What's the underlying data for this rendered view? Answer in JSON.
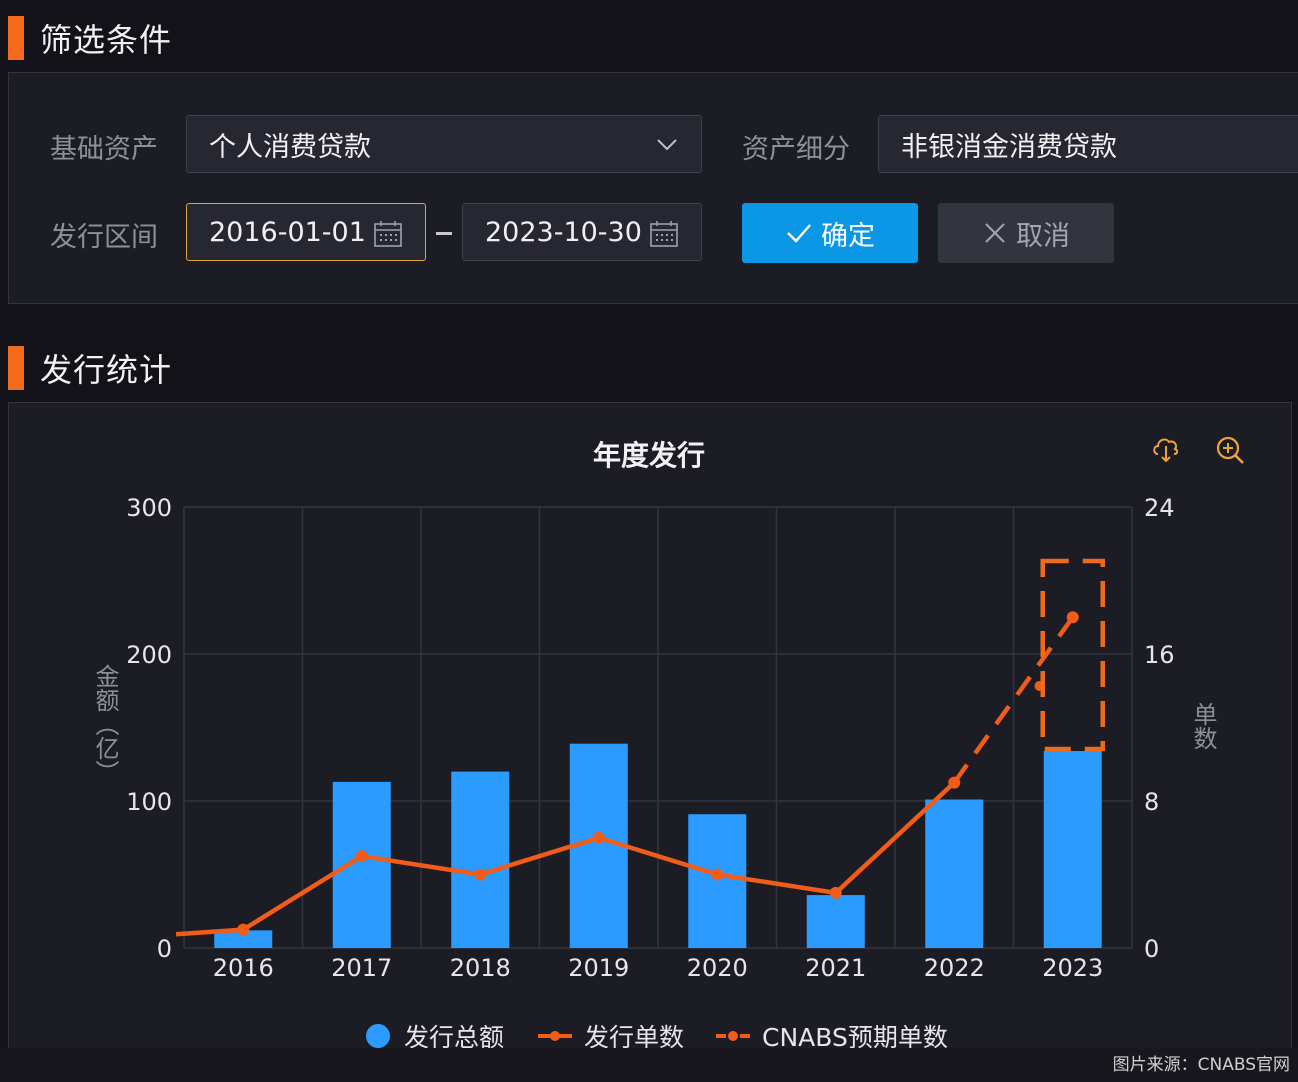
{
  "colors": {
    "accent": "#f26a1b",
    "primary": "#2b9bff",
    "confirm": "#0b96e6",
    "series_line": "#f25c19",
    "highlight": "#ef6b1c"
  },
  "filter": {
    "title": "筛选条件",
    "asset_label": "基础资产",
    "asset_value": "个人消费贷款",
    "subclass_label": "资产细分",
    "subclass_value": "非银消金消费贷款",
    "period_label": "发行区间",
    "start_date": "2016-01-01",
    "end_date": "2023-10-30",
    "confirm_label": "确定",
    "cancel_label": "取消",
    "icons": [
      "chevron-down-icon",
      "calendar-icon",
      "check-icon",
      "close-icon"
    ]
  },
  "stats": {
    "title": "发行统计",
    "icons": [
      "cloud-download-icon",
      "zoom-in-icon"
    ]
  },
  "chart_data": {
    "type": "bar",
    "title": "年度发行",
    "categories": [
      "2016",
      "2017",
      "2018",
      "2019",
      "2020",
      "2021",
      "2022",
      "2023"
    ],
    "ylabel": "金额（亿）",
    "y2label": "单数",
    "ylim": [
      0,
      300
    ],
    "y2lim": [
      0,
      24
    ],
    "yticks": [
      "0",
      "100",
      "200",
      "300"
    ],
    "y2ticks": [
      "0",
      "8",
      "16",
      "24"
    ],
    "grid": true,
    "legend_position": "bottom",
    "series": [
      {
        "name": "发行总额",
        "type": "bar",
        "axis": "left",
        "values": [
          12,
          113,
          120,
          139,
          91,
          36,
          101,
          134
        ]
      },
      {
        "name": "发行单数",
        "type": "line",
        "axis": "right",
        "values": [
          1,
          5,
          4,
          6,
          4,
          3,
          9,
          null
        ]
      },
      {
        "name": "CNABS预期单数",
        "type": "line-dashed",
        "axis": "right",
        "values": [
          null,
          null,
          null,
          null,
          null,
          null,
          9,
          18
        ]
      }
    ],
    "annotation": "2023 highlighted with dashed orange box"
  },
  "credit": "图片来源：CNABS官网"
}
